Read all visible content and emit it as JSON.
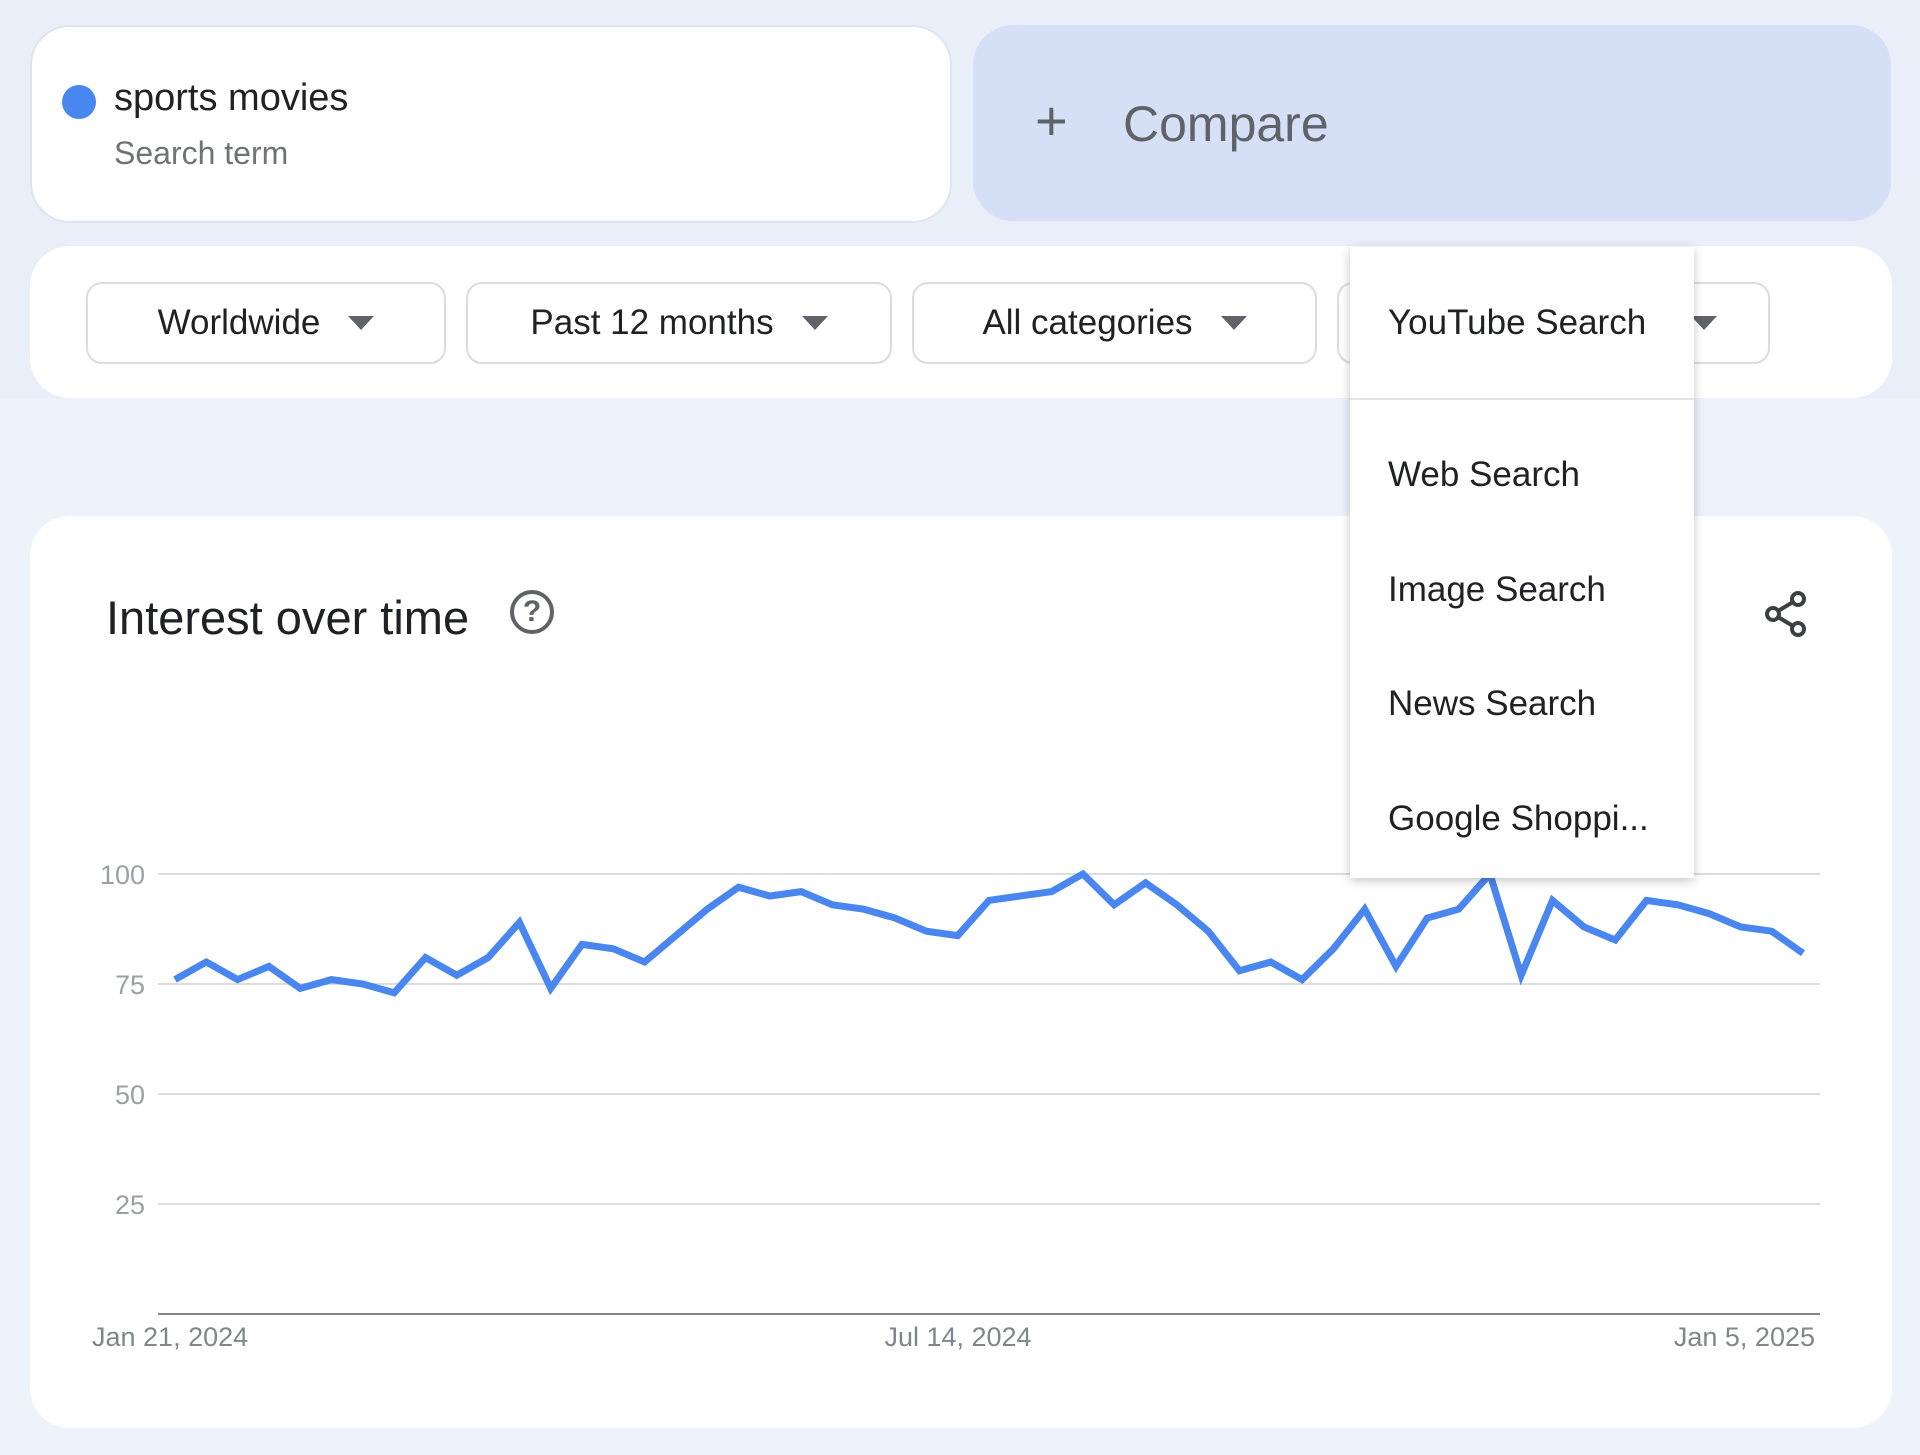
{
  "search_term": {
    "name": "sports movies",
    "type_label": "Search term",
    "color": "#4a86f0"
  },
  "compare": {
    "plus": "+",
    "label": "Compare"
  },
  "filters": {
    "region": "Worldwide",
    "time_range": "Past 12 months",
    "category": "All categories",
    "property": "YouTube Search"
  },
  "property_menu": {
    "selected": "YouTube Search",
    "options": [
      "Web Search",
      "Image Search",
      "News Search",
      "Google Shoppi..."
    ]
  },
  "interest_panel": {
    "title": "Interest over time",
    "help_icon": "question-circle-icon",
    "share_icon": "share-icon"
  },
  "chart_data": {
    "type": "line",
    "title": "",
    "xlabel": "",
    "ylabel": "",
    "x_tick_labels": [
      "Jan 21, 2024",
      "Jul 14, 2024",
      "Jan 5, 2025"
    ],
    "y_ticks": [
      25,
      50,
      75,
      100
    ],
    "ylim": [
      0,
      100
    ],
    "grid": true,
    "color": "#4a86f0",
    "series": [
      {
        "values": [
          76,
          80,
          76,
          79,
          74,
          76,
          75,
          73,
          81,
          77,
          81,
          89,
          74,
          84,
          83,
          80,
          86,
          92,
          97,
          95,
          96,
          93,
          92,
          90,
          87,
          86,
          94,
          95,
          96,
          100,
          93,
          98,
          93,
          87,
          78,
          80,
          76,
          83,
          92,
          79,
          90,
          92,
          100,
          77,
          94,
          88,
          85,
          94,
          93,
          91,
          88,
          87,
          82
        ]
      }
    ]
  }
}
